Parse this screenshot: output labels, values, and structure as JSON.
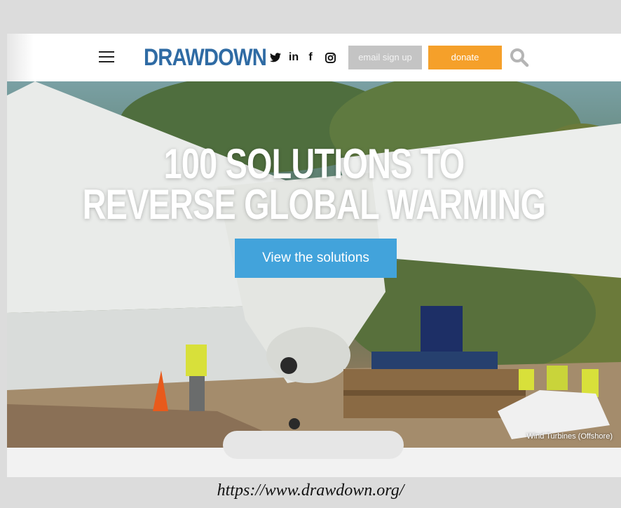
{
  "header": {
    "logo": "DRAWDOWN",
    "social": [
      {
        "name": "twitter",
        "glyph": "🐦"
      },
      {
        "name": "linkedin",
        "glyph": "in"
      },
      {
        "name": "facebook",
        "glyph": "f"
      },
      {
        "name": "instagram",
        "glyph": ""
      }
    ],
    "email_signup_label": "email sign up",
    "donate_label": "donate",
    "colors": {
      "logo": "#2f6ba4",
      "donate": "#f5a02a",
      "email": "#c4c4c4"
    }
  },
  "hero": {
    "title_line1": "100 SOLUTIONS TO",
    "title_line2": "REVERSE GLOBAL WARMING",
    "cta_label": "View the solutions",
    "caption": "Wind Turbines (Offshore)",
    "cta_color": "#42a3db"
  },
  "footer": {
    "url": "https://www.drawdown.org/"
  }
}
